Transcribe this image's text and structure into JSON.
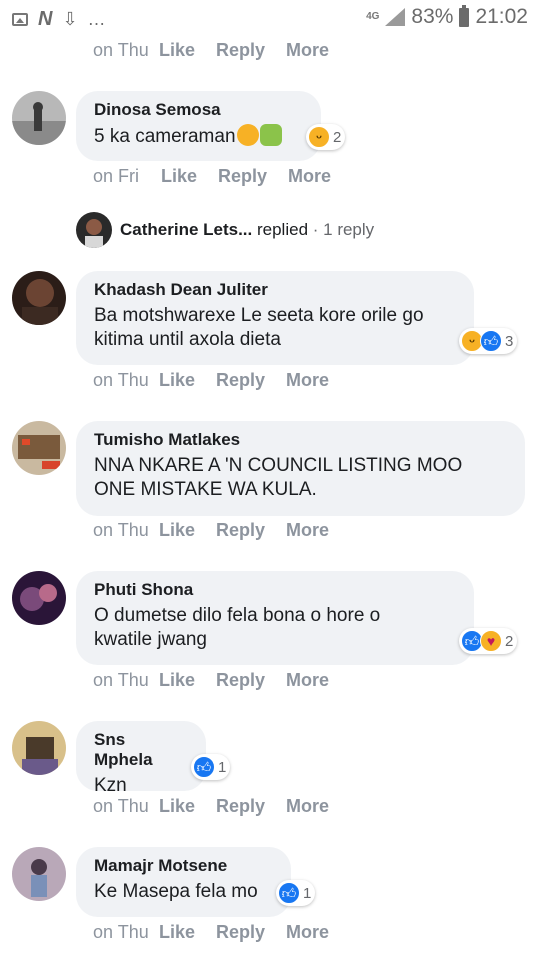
{
  "status_bar": {
    "network": "4G",
    "battery": "83%",
    "time": "21:02",
    "icons": [
      "image-icon",
      "n-app-icon",
      "download-icon",
      "more-notifications-icon"
    ]
  },
  "actions": {
    "like": "Like",
    "reply": "Reply",
    "more": "More"
  },
  "top_actions": {
    "time": "on Thu"
  },
  "comments": [
    {
      "name": "Dinosa Semosa",
      "text": "5 ka cameraman",
      "inline_emojis": [
        "laughing-tears-emoji",
        "facepalm-emoji"
      ],
      "time": "on Fri",
      "reactions": {
        "icons": [
          "haha"
        ],
        "count": "2"
      }
    },
    {
      "name": "Khadash Dean Juliter",
      "text_lines": [
        "Ba motshwarexe Le seeta kore orile go",
        "kitima until axola dieta"
      ],
      "time": "on Thu",
      "reactions": {
        "icons": [
          "haha",
          "like"
        ],
        "count": "3"
      }
    },
    {
      "name": "Tumisho Matlakes",
      "text_lines": [
        "NNA NKARE A 'N COUNCIL LISTING MOO",
        "ONE MISTAKE WA KULA."
      ],
      "time": "on Thu"
    },
    {
      "name": "Phuti Shona",
      "text_lines": [
        "O dumetse dilo fela bona o hore o",
        "kwatile jwang"
      ],
      "time": "on Thu",
      "reactions": {
        "icons": [
          "like",
          "care"
        ],
        "count": "2"
      }
    },
    {
      "name": "Sns Mphela",
      "text": "Kzn",
      "time": "on Thu",
      "reactions": {
        "icons": [
          "like"
        ],
        "count": "1"
      }
    },
    {
      "name": "Mamajr Motsene",
      "text": "Ke Masepa fela mo",
      "time": "on Thu",
      "reactions": {
        "icons": [
          "like"
        ],
        "count": "1"
      }
    }
  ],
  "reply_summary": {
    "name": "Catherine Lets...",
    "verb": " replied",
    "count": " · 1 reply"
  },
  "colors": {
    "bubble": "#f0f2f5",
    "meta_gray": "#8d949e",
    "like_blue": "#1877f2",
    "haha_yellow": "#f7b125"
  }
}
